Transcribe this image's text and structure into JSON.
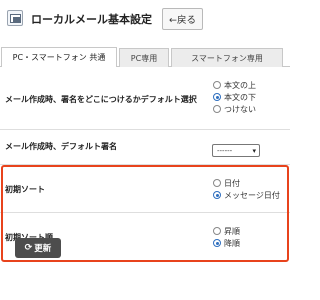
{
  "header": {
    "title": "ローカルメール基本設定",
    "back_label": "←戻る"
  },
  "tabs": [
    {
      "label": "PC・スマートフォン 共通",
      "active": true
    },
    {
      "label": "PC専用",
      "active": false
    },
    {
      "label": "スマートフォン専用",
      "active": false
    }
  ],
  "settings": {
    "default_signature_position": {
      "label": "メール作成時、署名をどこにつけるかデフォルト選択",
      "options": [
        "本文の上",
        "本文の下",
        "つけない"
      ],
      "selected": "本文の下"
    },
    "default_signature": {
      "label": "メール作成時、デフォルト署名",
      "value": "------"
    },
    "initial_sort": {
      "label": "初期ソート",
      "options": [
        "日付",
        "メッセージ日付"
      ],
      "selected": "メッセージ日付"
    },
    "initial_sort_order": {
      "label": "初期ソート順",
      "options": [
        "昇順",
        "降順"
      ],
      "selected": "降順"
    }
  },
  "footer": {
    "refresh_label": "更新"
  },
  "colors": {
    "highlight": "#e8431c",
    "radio_checked": "#2f6fbf",
    "refresh_button": "#4d4d4d"
  }
}
